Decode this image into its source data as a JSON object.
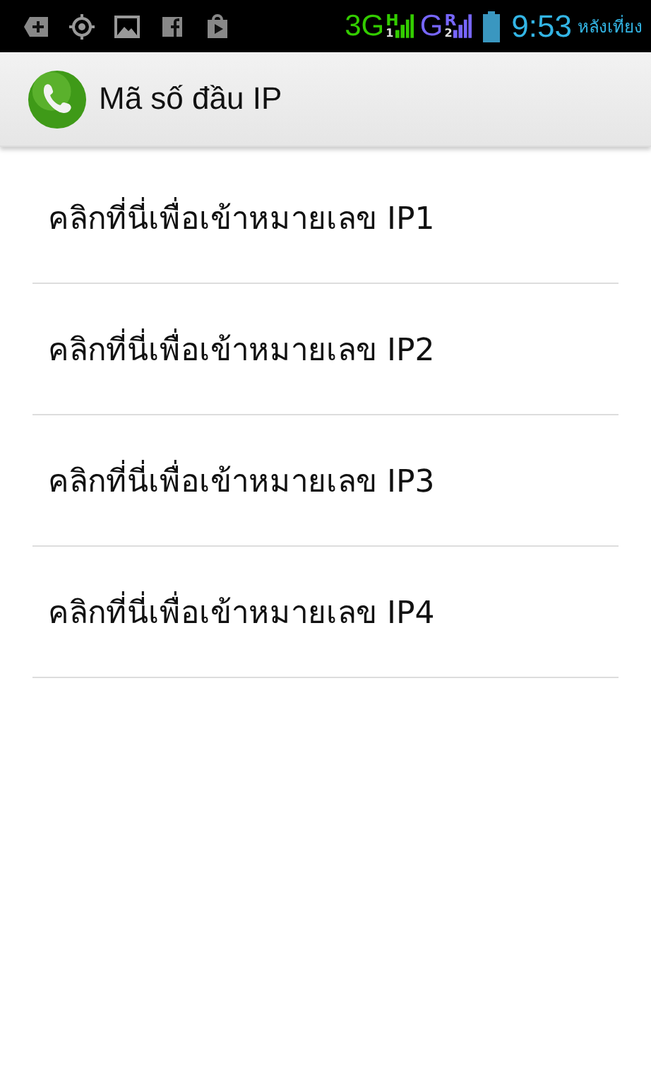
{
  "status_bar": {
    "networks": [
      {
        "type": "3G",
        "sub": "H",
        "sim": "1",
        "color": "#33cc00"
      },
      {
        "type": "G",
        "sub": "R",
        "sim": "2",
        "color": "#7766ff"
      }
    ],
    "time": "9:53",
    "period": "หลังเที่ยง"
  },
  "action_bar": {
    "title": "Mã số đầu IP"
  },
  "items": [
    {
      "label": "คลิกที่นี่เพื่อเข้าหมายเลข IP1"
    },
    {
      "label": "คลิกที่นี่เพื่อเข้าหมายเลข IP2"
    },
    {
      "label": "คลิกที่นี่เพื่อเข้าหมายเลข IP3"
    },
    {
      "label": "คลิกที่นี่เพื่อเข้าหมายเลข IP4"
    }
  ]
}
